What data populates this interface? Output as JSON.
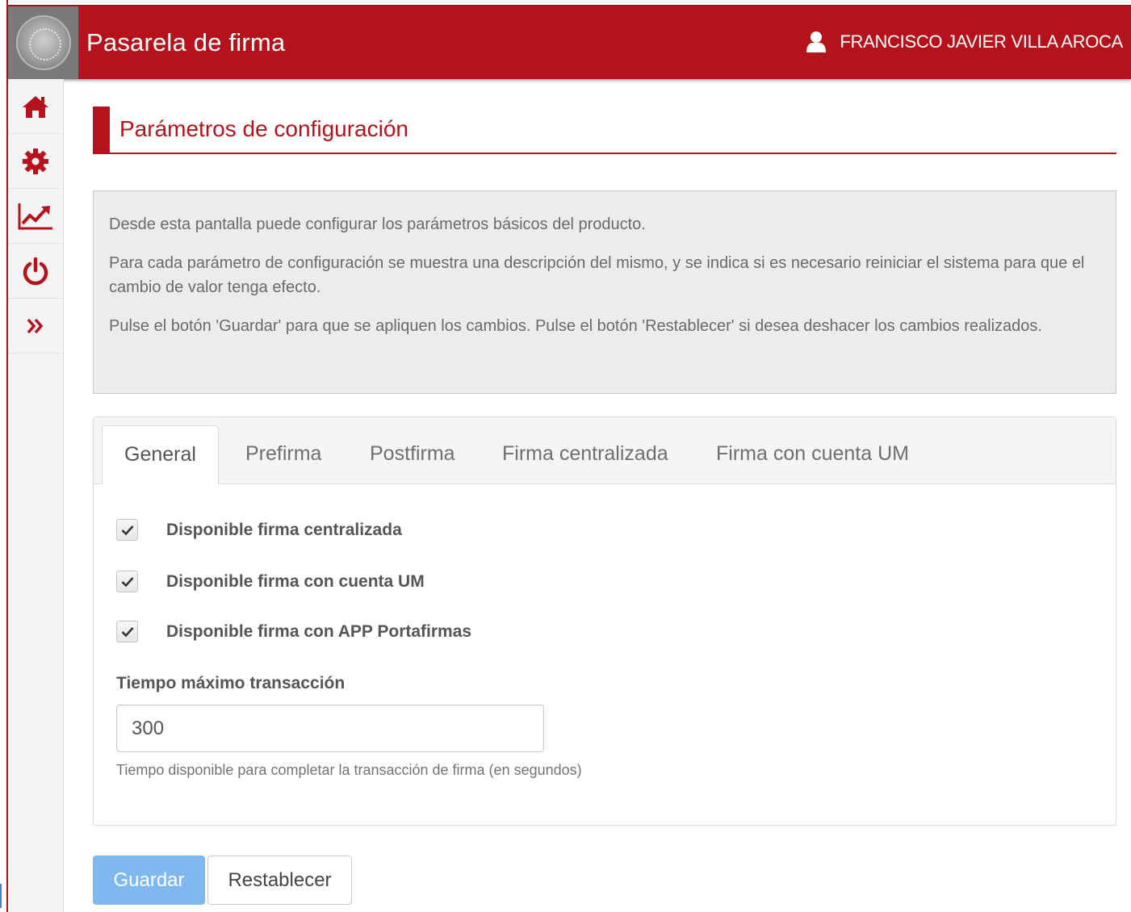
{
  "header": {
    "app_title": "Pasarela de firma",
    "user_name": "FRANCISCO JAVIER VILLA AROCA",
    "user_icon": "user-icon",
    "logo": "university-seal"
  },
  "sidebar": {
    "items": [
      {
        "icon": "home-icon"
      },
      {
        "icon": "gear-icon"
      },
      {
        "icon": "chart-line-icon"
      },
      {
        "icon": "power-icon"
      },
      {
        "icon": "double-chevron-right-icon"
      }
    ]
  },
  "page": {
    "title": "Parámetros de configuración",
    "info": [
      "Desde esta pantalla puede configurar los parámetros básicos del producto.",
      "Para cada parámetro de configuración se muestra una descripción del mismo, y se indica si es necesario reiniciar el sistema para que el cambio de valor tenga efecto.",
      "Pulse el botón 'Guardar' para que se apliquen los cambios. Pulse el botón 'Restablecer' si desea deshacer los cambios realizados."
    ]
  },
  "tabs": [
    {
      "label": "General",
      "active": true
    },
    {
      "label": "Prefirma"
    },
    {
      "label": "Postfirma"
    },
    {
      "label": "Firma centralizada"
    },
    {
      "label": "Firma con cuenta UM"
    }
  ],
  "general": {
    "options": [
      {
        "label": "Disponible firma centralizada",
        "checked": true
      },
      {
        "label": "Disponible firma con cuenta UM",
        "checked": true
      },
      {
        "label": "Disponible firma con APP Portafirmas",
        "checked": true
      }
    ],
    "timeout_label": "Tiempo máximo transacción",
    "timeout_value": "300",
    "timeout_help": "Tiempo disponible para completar la transacción de firma (en segundos)"
  },
  "buttons": {
    "save": "Guardar",
    "reset": "Restablecer"
  },
  "colors": {
    "brand_red": "#b5121b",
    "save_button": "#7fb8ee"
  }
}
